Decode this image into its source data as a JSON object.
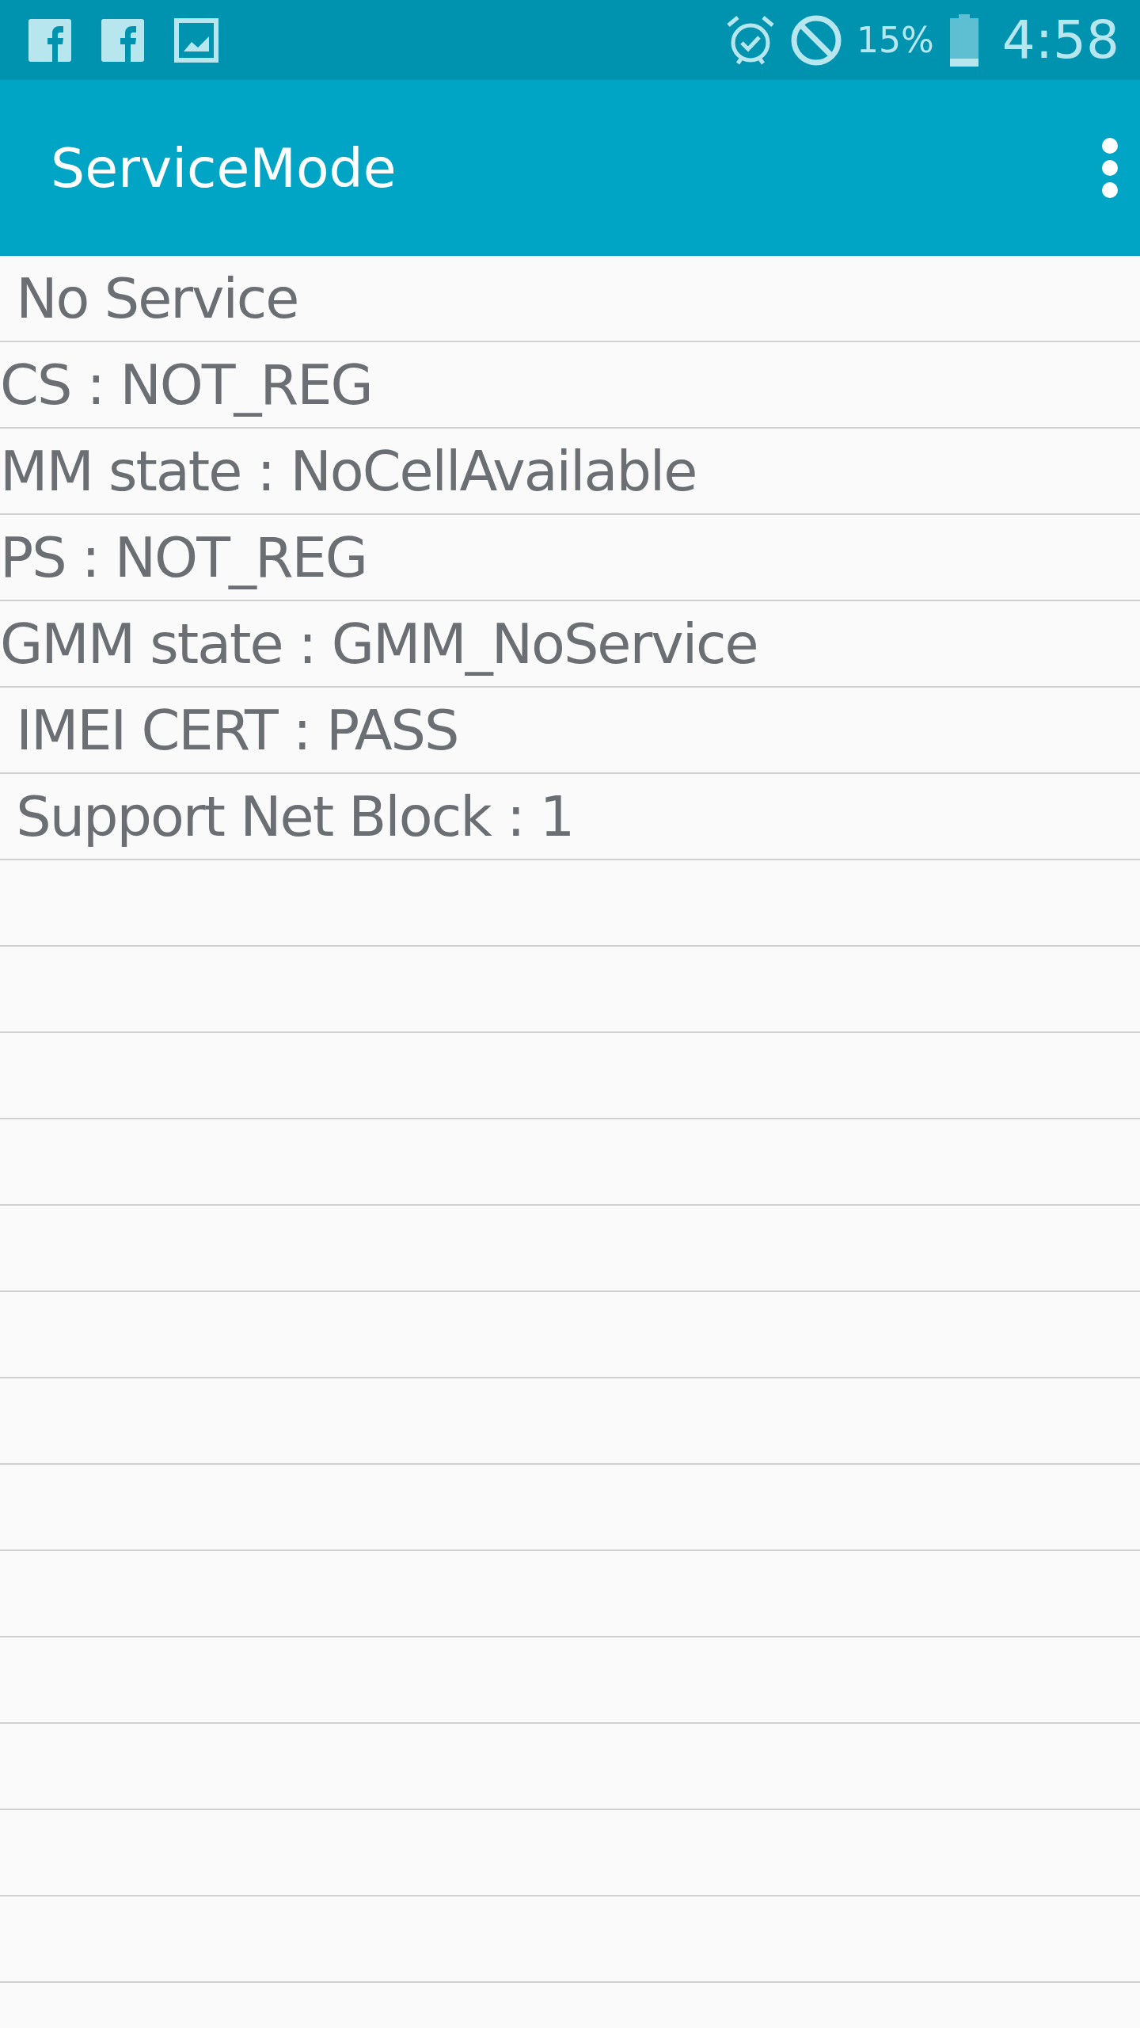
{
  "status_bar": {
    "battery": "15%",
    "time": "4:58"
  },
  "app_bar": {
    "title": "ServiceMode"
  },
  "rows": [
    {
      "text": " No Service"
    },
    {
      "text": "CS : NOT_REG"
    },
    {
      "text": "MM state : NoCellAvailable"
    },
    {
      "text": "PS : NOT_REG"
    },
    {
      "text": "GMM state : GMM_NoService"
    },
    {
      "text": " IMEI CERT : PASS"
    },
    {
      "text": " Support Net Block : 1"
    }
  ]
}
